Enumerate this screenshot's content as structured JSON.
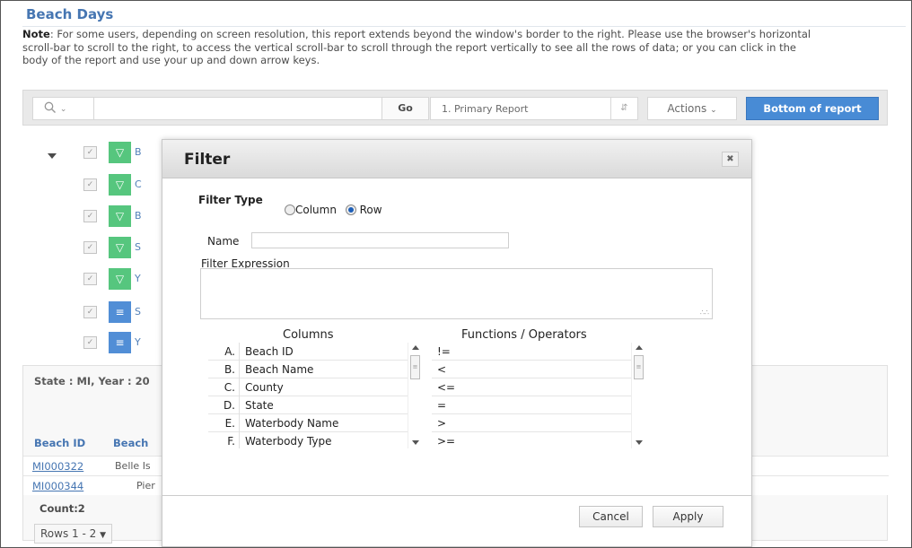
{
  "page": {
    "title": "Beach Days",
    "note_label": "Note",
    "note_text": ": For some users, depending on screen resolution, this report extends beyond the window's border to the right. Please use the browser's horizontal scroll-bar to scroll to the right, to access the vertical scroll-bar to scroll through the report vertically to see all the rows of data; or you can click in the body of the report and use your up and down arrow keys."
  },
  "toolbar": {
    "search_placeholder": "",
    "go_label": "Go",
    "report_select": "1. Primary Report",
    "actions_label": "Actions",
    "bottom_label": "Bottom of report",
    "accent_color": "#2f7bd0"
  },
  "filters": [
    {
      "icon": "filter-icon",
      "color": "#3fbf6d",
      "label": "B"
    },
    {
      "icon": "filter-icon",
      "color": "#3fbf6d",
      "label": "C"
    },
    {
      "icon": "filter-icon",
      "color": "#3fbf6d",
      "label": "B"
    },
    {
      "icon": "filter-icon",
      "color": "#3fbf6d",
      "label": "S"
    },
    {
      "icon": "filter-icon",
      "color": "#3fbf6d",
      "label": "Y"
    },
    {
      "icon": "sort-icon",
      "color": "#3a7fd1",
      "label": "S"
    },
    {
      "icon": "sort-icon",
      "color": "#3a7fd1",
      "label": "Y"
    }
  ],
  "report": {
    "state_line": "State : MI, Year : 20",
    "headers": [
      "Beach ID",
      "Beach"
    ],
    "rows": [
      {
        "id": "MI000322",
        "name": "Belle Is"
      },
      {
        "id": "MI000344",
        "name": "Pier"
      }
    ],
    "count": "Count:2",
    "pager": "Rows 1 - 2"
  },
  "modal": {
    "title": "Filter",
    "filter_type_label": "Filter Type",
    "radio_column": "Column",
    "radio_row": "Row",
    "selected_type": "Row",
    "name_label": "Name",
    "name_value": "",
    "expression_label": "Filter Expression",
    "expression_value": "",
    "columns_header": "Columns",
    "functions_header": "Functions / Operators",
    "columns": [
      {
        "letter": "A.",
        "name": "Beach ID"
      },
      {
        "letter": "B.",
        "name": "Beach Name"
      },
      {
        "letter": "C.",
        "name": "County"
      },
      {
        "letter": "D.",
        "name": "State"
      },
      {
        "letter": "E.",
        "name": "Waterbody Name"
      },
      {
        "letter": "F.",
        "name": "Waterbody Type"
      }
    ],
    "operators": [
      "!=",
      "<",
      "<=",
      "=",
      ">",
      ">="
    ],
    "cancel_label": "Cancel",
    "apply_label": "Apply"
  }
}
